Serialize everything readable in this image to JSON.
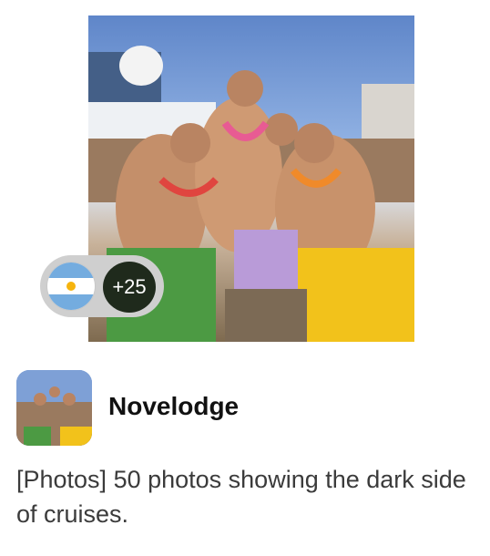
{
  "card": {
    "image_alt": "Men in leis and grass skirts partying on a cruise ship deck",
    "flag_icon": "argentina-flag-icon",
    "extra_count": "+25",
    "source": {
      "name": "Novelodge",
      "avatar_icon": "publisher-avatar"
    },
    "headline": "[Photos] 50 photos showing the dark side of cruises."
  },
  "colors": {
    "flag_blue": "#74acdf",
    "flag_sun": "#f6b40e",
    "pill_bg": "#cfcfcf",
    "count_bg": "#1f2a1c",
    "headline_text": "#3b3b3b",
    "source_text": "#111111"
  }
}
